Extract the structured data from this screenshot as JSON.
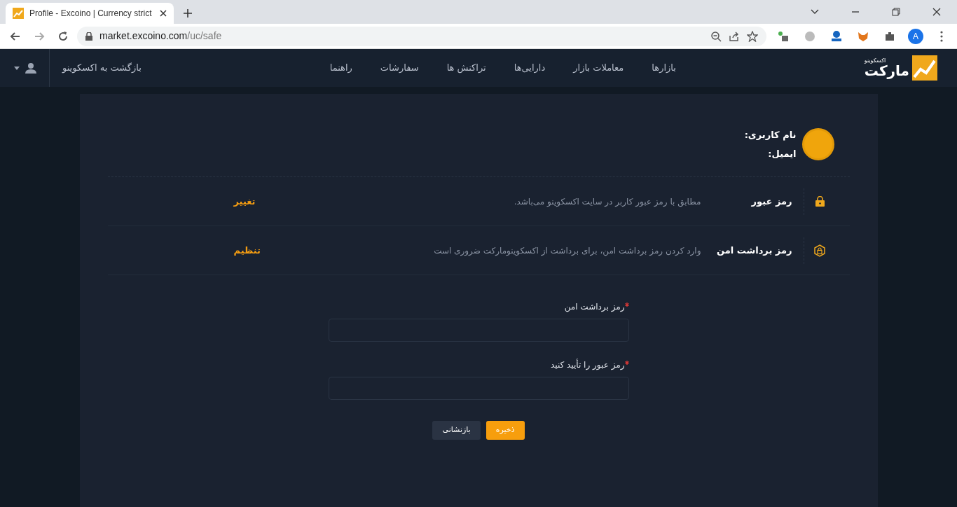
{
  "browser": {
    "tab_title": "Profile - Excoino | Currency strict",
    "url_host": "market.excoino.com",
    "url_path": "/uc/safe",
    "profile_initial": "A"
  },
  "navbar": {
    "logo_small": "اکسکوینو",
    "logo_big": "مارکت",
    "items": [
      "بازارها",
      "معاملات بازار",
      "دارایی‌ها",
      "تراکنش ها",
      "سفارشات",
      "راهنما"
    ],
    "back_link": "بازگشت به اکسکوینو"
  },
  "profile": {
    "labels": [
      "نام کاربری:",
      "ایمیل:"
    ]
  },
  "security_rows": [
    {
      "kind": "lock",
      "title": "رمز عبور",
      "description": "مطابق با رمز عبور کاربر در سایت اکسکوینو می‌باشد.",
      "action": "تغییر"
    },
    {
      "kind": "shield",
      "title": "رمز برداشت امن",
      "description": "وارد کردن رمز برداشت امن، برای برداشت از اکسکوینومارکت ضروری است",
      "action": "تنظیم"
    }
  ],
  "form": {
    "fields": [
      {
        "label": "رمز برداشت امن",
        "required": true
      },
      {
        "label": "رمز عبور را تأیید کنید",
        "required": true
      }
    ],
    "buttons": [
      {
        "kind": "primary",
        "label": "ذخیره"
      },
      {
        "kind": "secondary",
        "label": "بازنشانی"
      }
    ]
  }
}
